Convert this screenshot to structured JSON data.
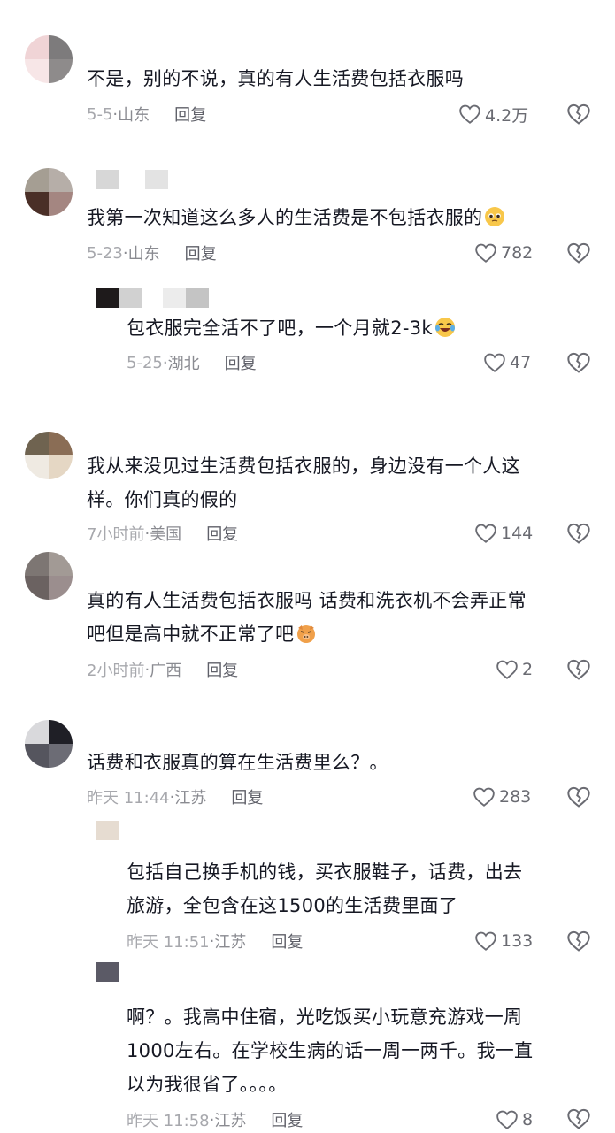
{
  "comments": [
    {
      "text": "不是，别的不说，真的有人生活费包括衣服吗",
      "date": "5-5",
      "location": "山东",
      "reply": "回复",
      "likes": "4.2万"
    },
    {
      "text": "我第一次知道这么多人的生活费是不包括衣服的",
      "date": "5-23",
      "location": "山东",
      "reply": "回复",
      "likes": "782",
      "emoji": "pleading-face-emoji"
    },
    {
      "text": "包衣服完全活不了吧，一个月就2-3k",
      "date": "5-25",
      "location": "湖北",
      "reply": "回复",
      "likes": "47",
      "emoji": "tears-of-joy-emoji"
    },
    {
      "text": "我从来没见过生活费包括衣服的，身边没有一个人这\n样。你们真的假的",
      "date": "7小时前",
      "location": "美国",
      "reply": "回复",
      "likes": "144"
    },
    {
      "text": "真的有人生活费包括衣服吗 话费和洗衣机不会弄正常\n吧但是高中就不正常了吧",
      "date": "2小时前",
      "location": "广西",
      "reply": "回复",
      "likes": "2",
      "emoji": "pig-face-emoji"
    },
    {
      "text": "话费和衣服真的算在生活费里么？。",
      "date": "昨天 11:44",
      "location": "江苏",
      "reply": "回复",
      "likes": "283"
    },
    {
      "text": "包括自己换手机的钱，买衣服鞋子，话费，出去\n旅游，全包含在这1500的生活费里面了",
      "date": "昨天 11:51",
      "location": "江苏",
      "reply": "回复",
      "likes": "133"
    },
    {
      "text": "啊？。我高中住宿，光吃饭买小玩意充游戏一周\n1000左右。在学校生病的话一周一两千。我一直\n以为我很省了。。。。",
      "date": "昨天 11:58",
      "location": "江苏",
      "reply": "回复",
      "likes": "8"
    }
  ],
  "icons": {
    "like": "heart-outline-icon",
    "dislike": "broken-heart-icon"
  },
  "colors": {
    "text": "#161823",
    "meta": "#8a8b91",
    "reply": "#5f6069"
  }
}
